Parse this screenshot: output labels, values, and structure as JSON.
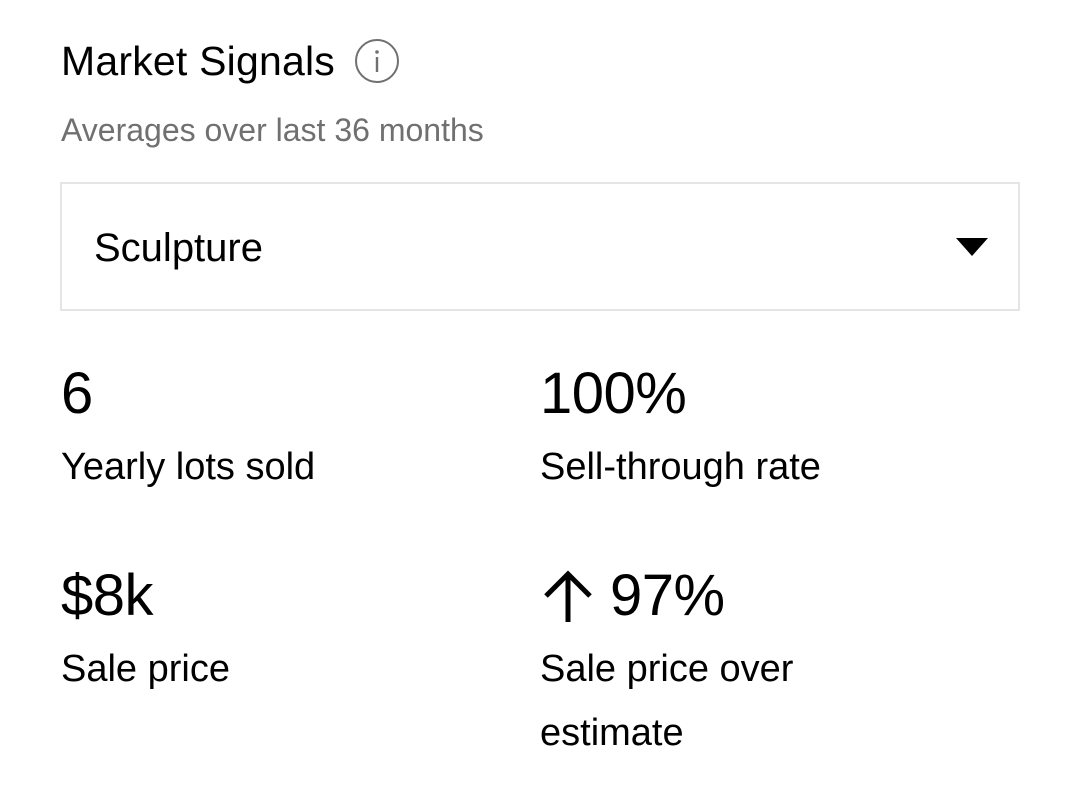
{
  "header": {
    "title": "Market Signals",
    "info_icon": "info-circle-icon",
    "subtitle": "Averages over last 36 months"
  },
  "category_select": {
    "selected": "Sculpture",
    "caret_icon": "caret-down-icon"
  },
  "stats": {
    "lots_sold": {
      "value": "6",
      "label": "Yearly lots sold"
    },
    "sell_through": {
      "value": "100%",
      "label": "Sell-through rate"
    },
    "sale_price": {
      "value": "$8k",
      "label": "Sale price"
    },
    "over_estimate": {
      "value": "97%",
      "label": "Sale price over estimate",
      "trend_icon": "arrow-up-icon"
    }
  },
  "colors": {
    "text": "#000000",
    "muted_text": "#707070",
    "border": "#e5e5e5",
    "background": "#ffffff"
  }
}
